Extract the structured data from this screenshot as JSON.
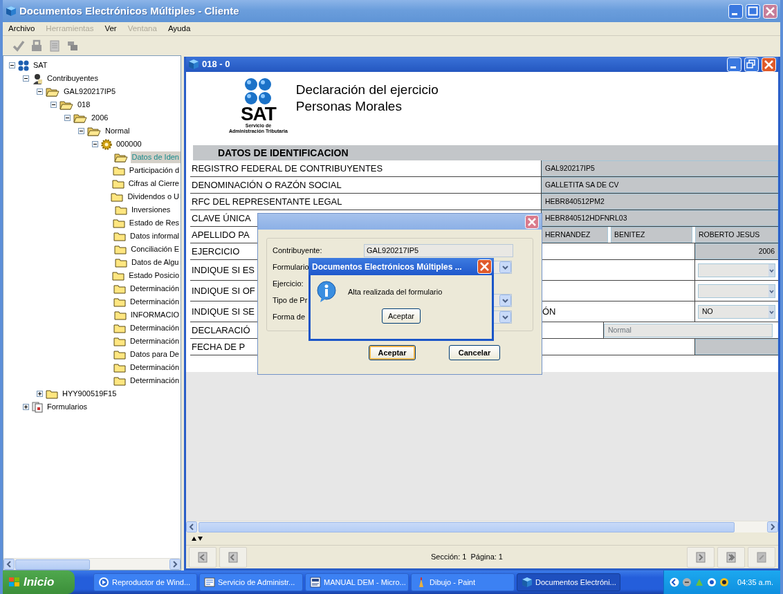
{
  "window": {
    "title": "Documentos Electrónicos Múltiples - Cliente"
  },
  "menu": [
    {
      "label": "Archivo",
      "disabled": false
    },
    {
      "label": "Herramientas",
      "disabled": true
    },
    {
      "label": "Ver",
      "disabled": false
    },
    {
      "label": "Ventana",
      "disabled": true
    },
    {
      "label": "Ayuda",
      "disabled": false
    }
  ],
  "tree": [
    {
      "label": "SAT",
      "kind": "network",
      "expanded": true,
      "selected": false,
      "children": [
        {
          "label": "Contribuyentes",
          "kind": "person",
          "expanded": true,
          "selected": false,
          "children": [
            {
              "label": "GAL920217IP5",
              "kind": "folder",
              "expanded": true,
              "selected": false,
              "children": [
                {
                  "label": "018",
                  "kind": "folder",
                  "expanded": true,
                  "selected": false,
                  "children": [
                    {
                      "label": "2006",
                      "kind": "folder",
                      "expanded": true,
                      "selected": false,
                      "children": [
                        {
                          "label": "Normal",
                          "kind": "folder",
                          "expanded": true,
                          "selected": false,
                          "children": [
                            {
                              "label": "000000",
                              "kind": "gear",
                              "expanded": true,
                              "selected": false,
                              "children": [
                                {
                                  "label": "Datos de Iden",
                                  "kind": "folder",
                                  "selected": true
                                },
                                {
                                  "label": "Participación d",
                                  "kind": "folder",
                                  "selected": false
                                },
                                {
                                  "label": "Cifras al Cierre",
                                  "kind": "folder",
                                  "selected": false
                                },
                                {
                                  "label": "Dividendos o U",
                                  "kind": "folder",
                                  "selected": false
                                },
                                {
                                  "label": "Inversiones",
                                  "kind": "folder",
                                  "selected": false
                                },
                                {
                                  "label": "Estado de Res",
                                  "kind": "folder",
                                  "selected": false
                                },
                                {
                                  "label": "Datos informal",
                                  "kind": "folder",
                                  "selected": false
                                },
                                {
                                  "label": "Conciliación E",
                                  "kind": "folder",
                                  "selected": false
                                },
                                {
                                  "label": "Datos de Algu",
                                  "kind": "folder",
                                  "selected": false
                                },
                                {
                                  "label": "Estado Posicio",
                                  "kind": "folder",
                                  "selected": false
                                },
                                {
                                  "label": "Determinación",
                                  "kind": "folder",
                                  "selected": false
                                },
                                {
                                  "label": "Determinación",
                                  "kind": "folder",
                                  "selected": false
                                },
                                {
                                  "label": "INFORMACIO",
                                  "kind": "folder",
                                  "selected": false
                                },
                                {
                                  "label": "Determinación",
                                  "kind": "folder",
                                  "selected": false
                                },
                                {
                                  "label": "Determinación",
                                  "kind": "folder",
                                  "selected": false
                                },
                                {
                                  "label": "Datos para De",
                                  "kind": "folder",
                                  "selected": false
                                },
                                {
                                  "label": "Determinación",
                                  "kind": "folder",
                                  "selected": false
                                },
                                {
                                  "label": "Determinación",
                                  "kind": "folder",
                                  "selected": false
                                }
                              ]
                            }
                          ]
                        }
                      ]
                    }
                  ]
                }
              ]
            },
            {
              "label": "HYY900519F15",
              "kind": "folder",
              "expanded": false,
              "selected": false
            }
          ]
        },
        {
          "label": "Formularios",
          "kind": "forms",
          "expanded": false,
          "selected": false
        }
      ]
    }
  ],
  "document_window": {
    "title": "018 - 0",
    "logo_text": "SAT",
    "logo_caption": [
      "Servicio de",
      "Administración Tributaria"
    ],
    "heading": [
      "Declaración del ejercicio",
      "Personas Morales"
    ],
    "section": "DATOS DE IDENTIFICACION",
    "rows": [
      {
        "label": "REGISTRO FEDERAL DE CONTRIBUYENTES",
        "kind": "field",
        "values": [
          "GAL920217IP5"
        ]
      },
      {
        "label": "DENOMINACIÓN O RAZÓN SOCIAL",
        "kind": "field",
        "values": [
          "GALLETITA SA DE CV"
        ]
      },
      {
        "label": "RFC DEL REPRESENTANTE LEGAL",
        "kind": "field",
        "values": [
          "HEBR840512PM2"
        ]
      },
      {
        "label": "CLAVE ÚNICA",
        "kind": "field",
        "values": [
          "HEBR840512HDFNRL03"
        ]
      },
      {
        "label": "APELLIDO PA",
        "kind": "name",
        "values": [
          "HERNANDEZ",
          "BENITEZ",
          "ROBERTO JESUS"
        ]
      },
      {
        "label": "EJERCICIO",
        "kind": "number",
        "values": [
          "2006"
        ]
      },
      {
        "label": "INDIQUE SI ES",
        "kind": "select",
        "values": []
      },
      {
        "label": "INDIQUE SI OF",
        "kind": "select",
        "values": []
      },
      {
        "label": "INDIQUE SI SE",
        "label_tail": "ÓN",
        "kind": "select",
        "values": [
          "NO"
        ]
      },
      {
        "label": "DECLARACIÓ",
        "kind": "disabled",
        "values": [
          "Normal"
        ]
      },
      {
        "label": "FECHA DE P",
        "kind": "blank",
        "values": []
      }
    ],
    "status": "Sección: 1  Página: 1"
  },
  "new_form_dialog": {
    "fields": [
      {
        "label": "Contribuyente:",
        "kind": "text",
        "value": "GAL920217IP5"
      },
      {
        "label": "Formulario",
        "kind": "select"
      },
      {
        "label": "Ejercicio:",
        "kind": "plain"
      },
      {
        "label": "Tipo de Pr",
        "kind": "select"
      },
      {
        "label": "Forma de",
        "kind": "select"
      }
    ],
    "buttons": [
      {
        "label": "Aceptar",
        "default": true
      },
      {
        "label": "Cancelar",
        "default": false
      }
    ]
  },
  "message_box": {
    "title": "Documentos Electrónicos Múltiples ...",
    "message": "Alta realizada del formulario",
    "button": "Aceptar"
  },
  "taskbar": {
    "start": "Inicio",
    "tasks": [
      {
        "label": "Reproductor de Wind...",
        "selected": false
      },
      {
        "label": "Servicio de Administr...",
        "selected": false
      },
      {
        "label": "MANUAL DEM - Micro...",
        "selected": false
      },
      {
        "label": "Dibujo - Paint",
        "selected": false
      },
      {
        "label": "Documentos Electróni...",
        "selected": true
      }
    ],
    "clock": "04:35 a.m."
  }
}
